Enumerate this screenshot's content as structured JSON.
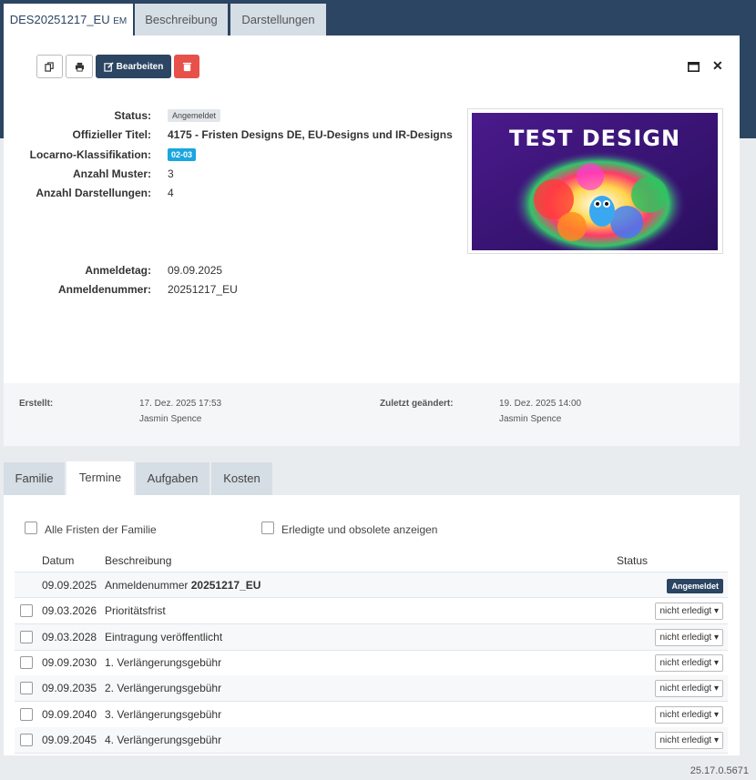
{
  "tabs": [
    {
      "label": "DES20251217_EU",
      "suffix": "EM"
    },
    {
      "label": "Beschreibung"
    },
    {
      "label": "Darstellungen"
    }
  ],
  "toolbar": {
    "edit_label": "Bearbeiten"
  },
  "fields": {
    "status_label": "Status:",
    "status_value": "Angemeldet",
    "title_label": "Offizieller Titel:",
    "title_value": "4175 - Fristen Designs DE, EU-Designs und IR-Designs",
    "locarno_label": "Locarno-Klassifikation:",
    "locarno_value": "02-03",
    "count_label": "Anzahl Muster:",
    "count_value": "3",
    "reps_label": "Anzahl Darstellungen:",
    "reps_value": "4",
    "filing_date_label": "Anmeldetag:",
    "filing_date_value": "09.09.2025",
    "filing_no_label": "Anmeldenummer:",
    "filing_no_value": "20251217_EU"
  },
  "design_image": {
    "text": "TEST DESIGN"
  },
  "meta": {
    "created_label": "Erstellt:",
    "created_date": "17. Dez. 2025 17:53",
    "created_by": "Jasmin Spence",
    "modified_label": "Zuletzt geändert:",
    "modified_date": "19. Dez. 2025 14:00",
    "modified_by": "Jasmin Spence"
  },
  "lower_tabs": [
    "Familie",
    "Termine",
    "Aufgaben",
    "Kosten"
  ],
  "filters": {
    "all_family": "Alle Fristen der Familie",
    "show_done": "Erledigte und obsolete anzeigen"
  },
  "table": {
    "headers": {
      "date": "Datum",
      "desc": "Beschreibung",
      "status": "Status"
    },
    "first_row": {
      "date": "09.09.2025",
      "desc": "Anmeldenummer",
      "desc_bold": "20251217_EU",
      "status": "Angemeldet"
    },
    "rows": [
      {
        "date": "09.03.2026",
        "desc": "Prioritätsfrist",
        "status": "nicht erledigt"
      },
      {
        "date": "09.03.2028",
        "desc": "Eintragung veröffentlicht",
        "status": "nicht erledigt"
      },
      {
        "date": "09.09.2030",
        "desc": "1. Verlängerungsgebühr",
        "status": "nicht erledigt"
      },
      {
        "date": "09.09.2035",
        "desc": "2. Verlängerungsgebühr",
        "status": "nicht erledigt"
      },
      {
        "date": "09.09.2040",
        "desc": "3. Verlängerungsgebühr",
        "status": "nicht erledigt"
      },
      {
        "date": "09.09.2045",
        "desc": "4. Verlängerungsgebühr",
        "status": "nicht erledigt"
      }
    ]
  },
  "version": "25.17.0.5671"
}
